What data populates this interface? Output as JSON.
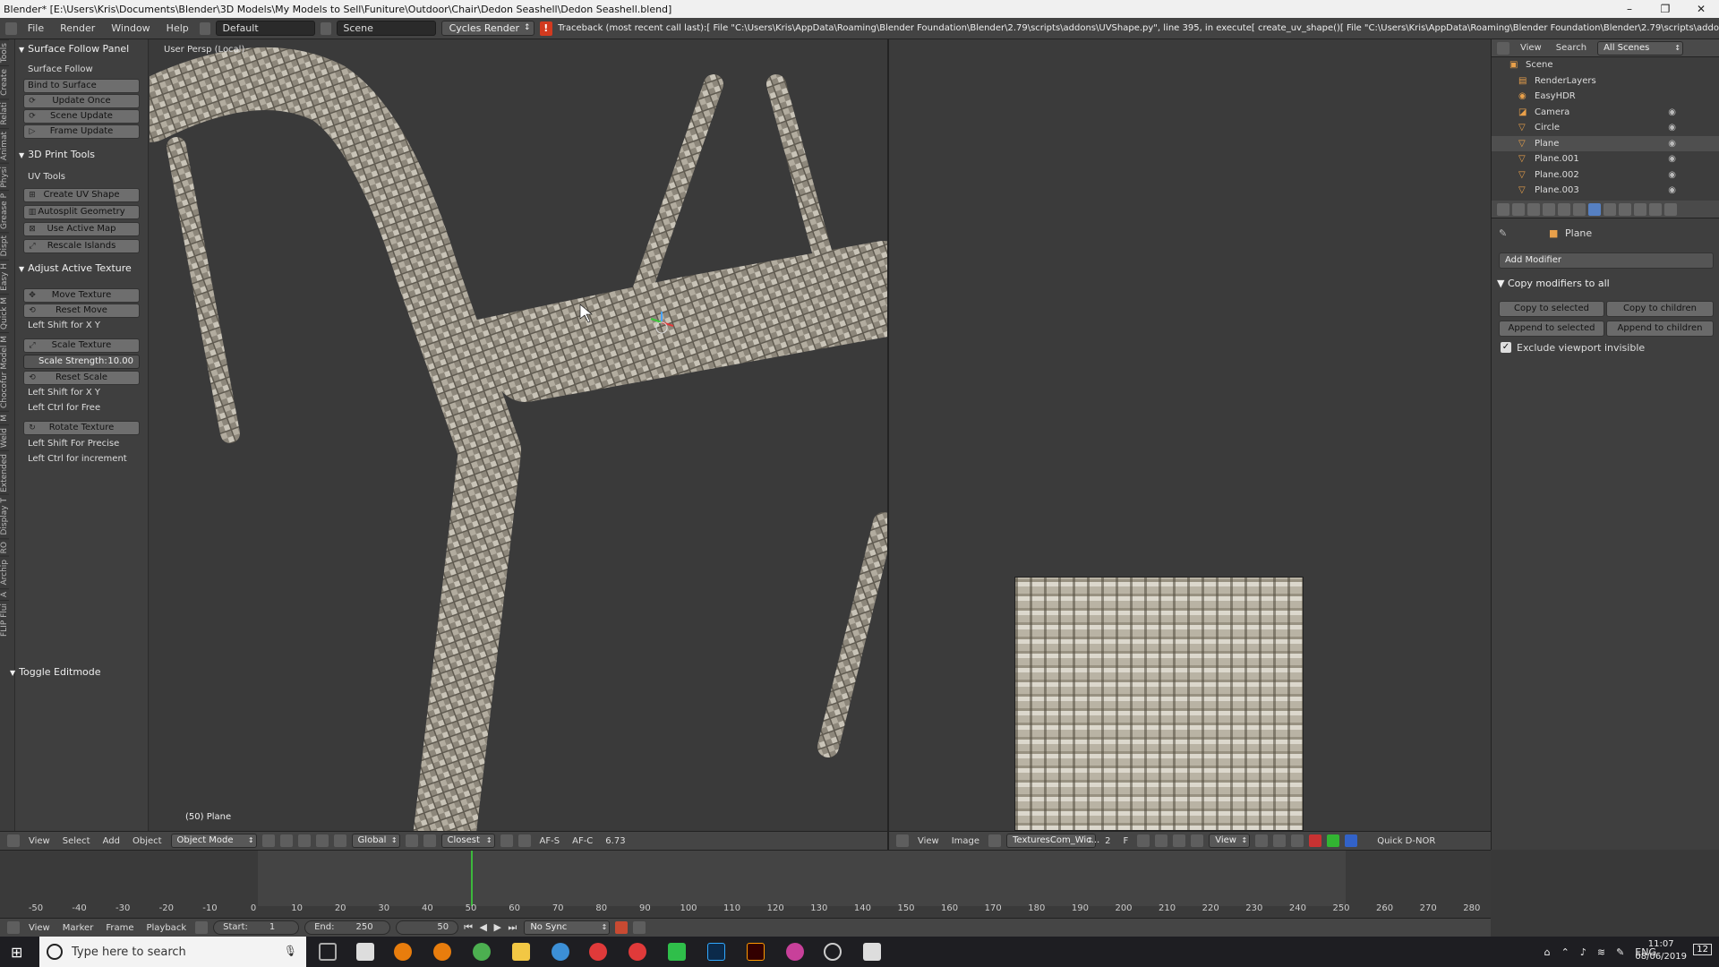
{
  "window": {
    "title": "Blender* [E:\\Users\\Kris\\Documents\\Blender\\3D Models\\My Models to Sell\\Funiture\\Outdoor\\Chair\\Dedon Seashell\\Dedon Seashell.blend]",
    "minimize": "–",
    "maximize": "❐",
    "close": "✕"
  },
  "topbar": {
    "menus": [
      "File",
      "Render",
      "Window",
      "Help"
    ],
    "layout": "Default",
    "scene": "Scene",
    "engine": "Cycles Render",
    "traceback": "Traceback (most recent call last):[   File \"C:\\Users\\Kris\\AppData\\Roaming\\Blender Foundation\\Blender\\2.79\\scripts\\addons\\UVShape.py\", line 395, in execute[     create_uv_shape()[   File \"C:\\Users\\Kris\\AppData\\Roaming\\Blender Foundation\\Blender\\2.79\\scripts\\addo"
  },
  "tool_tabs": [
    "Tools",
    "Create",
    "Relati",
    "Animat",
    "Physi",
    "Grease P",
    "Dispt",
    "Easy H",
    "Quick M",
    "Chocofur Model M",
    "M",
    "Weld",
    "Extended",
    "Display T",
    "RO",
    "Archip",
    "A",
    "FLIP Flui"
  ],
  "toolshelf": {
    "surface_follow": {
      "header": "Surface Follow Panel",
      "label": "Surface Follow",
      "bind": "Bind to Surface",
      "update_once": "Update Once",
      "scene_update": "Scene Update",
      "frame_update": "Frame Update"
    },
    "print_tools": {
      "header": "3D Print Tools",
      "label": "UV Tools",
      "create_uv_shape": "Create UV Shape",
      "autosplit": "Autosplit Geometry",
      "use_active_map": "Use Active Map",
      "rescale_islands": "Rescale Islands"
    },
    "adjust_texture": {
      "header": "Adjust Active Texture",
      "move_texture": "Move Texture",
      "reset_move": "Reset Move",
      "hint_move": "Left Shift for X Y",
      "scale_texture": "Scale Texture",
      "scale_strength_label": "Scale Strength:",
      "scale_strength_value": "10.00",
      "reset_scale": "Reset Scale",
      "hint_scale_1": "Left Shift for X Y",
      "hint_scale_2": "Left Ctrl for Free",
      "rotate_texture": "Rotate Texture",
      "hint_rotate_1": "Left Shift For Precise",
      "hint_rotate_2": "Left Ctrl for increment"
    },
    "toggle_editmode": "Toggle Editmode"
  },
  "viewport": {
    "view_label": "User Persp (Local)",
    "object_label": "(50) Plane"
  },
  "header_3d": {
    "menus": [
      "View",
      "Select",
      "Add",
      "Object"
    ],
    "mode": "Object Mode",
    "orientation": "Global",
    "snap": "Closest",
    "afs": "AF-S",
    "afc": "AF-C",
    "value": "6.73"
  },
  "header_image": {
    "menus": [
      "View",
      "Image"
    ],
    "image_name": "TexturesCom_Wic...",
    "users": "2",
    "fake": "F",
    "view": "View",
    "quick": "Quick D-NOR"
  },
  "outliner": {
    "view": "View",
    "search": "Search",
    "scenes": "All Scenes",
    "items": [
      {
        "name": "Scene",
        "icon": "▣"
      },
      {
        "name": "RenderLayers",
        "icon": "▤"
      },
      {
        "name": "EasyHDR",
        "icon": "◉"
      },
      {
        "name": "Camera",
        "icon": "◪"
      },
      {
        "name": "Circle",
        "icon": "▽"
      },
      {
        "name": "Plane",
        "icon": "▽"
      },
      {
        "name": "Plane.001",
        "icon": "▽"
      },
      {
        "name": "Plane.002",
        "icon": "▽"
      },
      {
        "name": "Plane.003",
        "icon": "▽"
      }
    ]
  },
  "properties": {
    "object": "Plane",
    "add_modifier": "Add Modifier",
    "copy_header": "Copy modifiers to all",
    "copy_selected": "Copy to selected",
    "copy_children": "Copy to children",
    "append_selected": "Append to selected",
    "append_children": "Append to children",
    "exclude": "Exclude viewport invisible"
  },
  "timeline": {
    "ticks": [
      "-50",
      "-40",
      "-30",
      "-20",
      "-10",
      "0",
      "10",
      "20",
      "30",
      "40",
      "50",
      "60",
      "70",
      "80",
      "90",
      "100",
      "110",
      "120",
      "130",
      "140",
      "150",
      "160",
      "170",
      "180",
      "190",
      "200",
      "210",
      "220",
      "230",
      "240",
      "250",
      "260",
      "270",
      "280"
    ],
    "menus": [
      "View",
      "Marker",
      "Frame",
      "Playback"
    ],
    "start_label": "Start:",
    "start_value": "1",
    "end_label": "End:",
    "end_value": "250",
    "current": "50",
    "sync": "No Sync"
  },
  "taskbar": {
    "search_placeholder": "Type here to search",
    "lang": "ENG",
    "time": "11:07",
    "date": "08/06/2019",
    "notif": "12"
  },
  "colors": {
    "accent": "#5680c2",
    "warning": "#d23a1f",
    "playhead": "#3cb83c"
  }
}
